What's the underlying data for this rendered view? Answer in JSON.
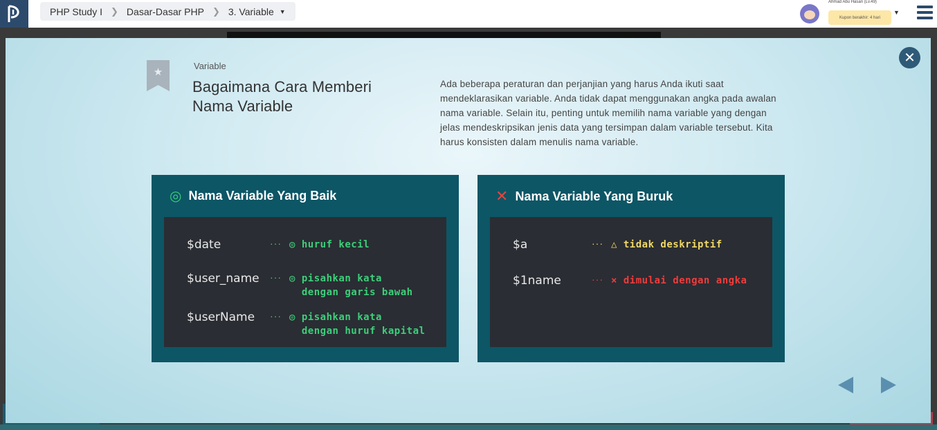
{
  "header": {
    "breadcrumb": [
      "PHP Study I",
      "Dasar-Dasar PHP",
      "3. Variable"
    ],
    "username": "Ahmad Abu Hasan (Lv.49)",
    "coupon": "Kupon berakhir: 4 hari"
  },
  "slide": {
    "category": "Variable",
    "title": "Bagaimana Cara Memberi Nama Variable",
    "description": "Ada beberapa peraturan dan perjanjian yang harus Anda ikuti saat mendeklarasikan variable. Anda tidak dapat menggunakan angka pada awalan nama variable. Selain itu, penting untuk memilih nama variable yang dengan jelas mendeskripsikan jenis data yang tersimpan dalam variable tersebut. Kita harus konsisten dalam menulis nama variable.",
    "good": {
      "heading": "Nama Variable Yang Baik",
      "mark": "◎",
      "rows": [
        {
          "var": "$date",
          "dots": "···",
          "note": "◎ huruf kecil"
        },
        {
          "var": "$user_name",
          "dots": "···",
          "note": "◎ pisahkan kata\n  dengan garis bawah"
        },
        {
          "var": "$userName",
          "dots": "···",
          "note": "◎ pisahkan kata\n  dengan huruf kapital"
        }
      ]
    },
    "bad": {
      "heading": "Nama Variable Yang Buruk",
      "mark": "✕",
      "rows": [
        {
          "var": "$a",
          "dots": "···",
          "note": "△ tidak deskriptif"
        },
        {
          "var": "$1name",
          "dots": "···",
          "note": "× dimulai dengan angka"
        }
      ]
    }
  },
  "colors": {
    "panel": "#0d5666",
    "board": "#2a2d33",
    "good": "#3ccf7a",
    "warn": "#f0d866",
    "error": "#ee3c3c",
    "accent": "#2e5a78"
  }
}
